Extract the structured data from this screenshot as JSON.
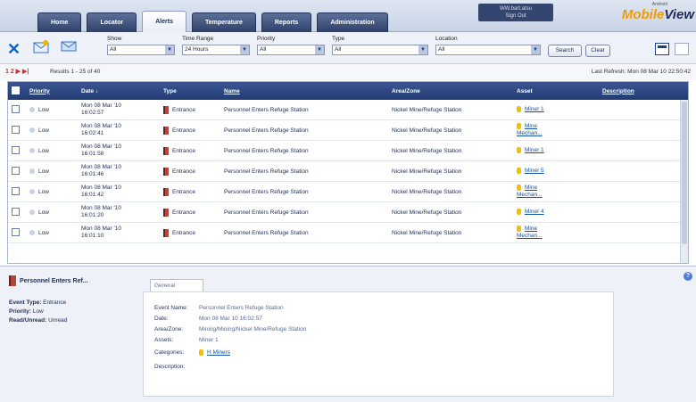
{
  "tabs": [
    {
      "label": "Home"
    },
    {
      "label": "Locator"
    },
    {
      "label": "Alerts"
    },
    {
      "label": "Temperature"
    },
    {
      "label": "Reports"
    },
    {
      "label": "Administration"
    }
  ],
  "user": {
    "line1": "WW.bart.atsu",
    "line2": "Sign Out"
  },
  "brand": {
    "sub": "Android",
    "logo_a": "Mobile",
    "logo_b": "View"
  },
  "filters": {
    "show_label": "Show",
    "show_value": "All",
    "time_label": "Time Range",
    "time_value": "24 Hours",
    "priority_label": "Priority",
    "priority_value": "All",
    "type_label": "Type",
    "type_value": "All",
    "location_label": "Location",
    "location_value": "All",
    "search_label": "Search",
    "clear_label": "Clear"
  },
  "results": {
    "pager": "1 2 ▶ ▶|",
    "text": "Results 1 - 25 of 40",
    "refresh": "Last Refresh: Mon 08 Mar 10 22:50:42"
  },
  "table": {
    "headers": {
      "priority": "Priority",
      "date": "Date ↓",
      "type": "Type",
      "name": "Name",
      "area": "Area/Zone",
      "asset": "Asset",
      "description": "Description"
    },
    "rows": [
      {
        "priority": "Low",
        "date1": "Mon 08 Mar '10",
        "date2": "16:02:57",
        "type": "Entrance",
        "name": "Personnel Enters Refuge Station",
        "area": "Nickel Mine/Refuge Station",
        "asset1": "Miner 1",
        "asset2": ""
      },
      {
        "priority": "Low",
        "date1": "Mon 08 Mar '10",
        "date2": "16:02:41",
        "type": "Entrance",
        "name": "Personnel Enters Refuge Station",
        "area": "Nickel Mine/Refuge Station",
        "asset1": "Mine",
        "asset2": "Mechan..."
      },
      {
        "priority": "Low",
        "date1": "Mon 08 Mar '10",
        "date2": "16:01:58",
        "type": "Entrance",
        "name": "Personnel Enters Refuge Station",
        "area": "Nickel Mine/Refuge Station",
        "asset1": "Miner 1",
        "asset2": ""
      },
      {
        "priority": "Low",
        "date1": "Mon 08 Mar '10",
        "date2": "16:01:46",
        "type": "Entrance",
        "name": "Personnel Enters Refuge Station",
        "area": "Nickel Mine/Refuge Station",
        "asset1": "Miner 5",
        "asset2": ""
      },
      {
        "priority": "Low",
        "date1": "Mon 08 Mar '10",
        "date2": "16:01:42",
        "type": "Entrance",
        "name": "Personnel Enters Refuge Station",
        "area": "Nickel Mine/Refuge Station",
        "asset1": "Mine",
        "asset2": "Mechan..."
      },
      {
        "priority": "Low",
        "date1": "Mon 08 Mar '10",
        "date2": "16:01:20",
        "type": "Entrance",
        "name": "Personnel Enters Refuge Station",
        "area": "Nickel Mine/Refuge Station",
        "asset1": "Miner 4",
        "asset2": ""
      },
      {
        "priority": "Low",
        "date1": "Mon 08 Mar '10",
        "date2": "16:01:10",
        "type": "Entrance",
        "name": "Personnel Enters Refuge Station",
        "area": "Nickel Mine/Refuge Station",
        "asset1": "Mine",
        "asset2": "Mechan..."
      }
    ]
  },
  "detail": {
    "title": "Personnel Enters Ref...",
    "event_type_k": "Event Type:",
    "event_type_v": "Entrance",
    "priority_k": "Priority:",
    "priority_v": "Low",
    "read_k": "Read/Unread:",
    "read_v": "Unread",
    "tab": "General",
    "event_name_k": "Event Name:",
    "event_name_v": "Personnel Enters Refuge Station",
    "date_k": "Date:",
    "date_v": "Mon 08 Mar 10 16:02:57",
    "area_k": "Area/Zone:",
    "area_v": "Mining/Mining/Nickel Mine/Refuge Station",
    "assets_k": "Assets:",
    "assets_v": "Miner 1",
    "categories_k": "Categories:",
    "categories_v": "H Miners",
    "description_k": "Description:"
  }
}
